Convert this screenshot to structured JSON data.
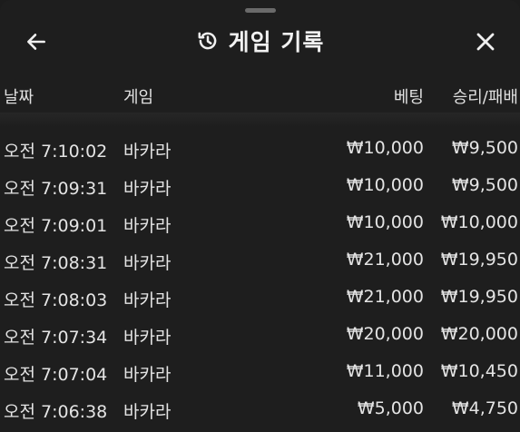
{
  "header": {
    "title": "게임 기록",
    "back_icon": "arrow-left-icon",
    "history_icon": "history-icon",
    "close_icon": "close-icon"
  },
  "columns": {
    "date": "날짜",
    "game": "게임",
    "bet": "베팅",
    "result": "승리/패배"
  },
  "rows": [
    {
      "time": "오전 7:10:02",
      "game": "바카라",
      "bet": "₩10,000",
      "result": "₩9,500"
    },
    {
      "time": "오전 7:09:31",
      "game": "바카라",
      "bet": "₩10,000",
      "result": "₩9,500"
    },
    {
      "time": "오전 7:09:01",
      "game": "바카라",
      "bet": "₩10,000",
      "result": "₩10,000"
    },
    {
      "time": "오전 7:08:31",
      "game": "바카라",
      "bet": "₩21,000",
      "result": "₩19,950"
    },
    {
      "time": "오전 7:08:03",
      "game": "바카라",
      "bet": "₩21,000",
      "result": "₩19,950"
    },
    {
      "time": "오전 7:07:34",
      "game": "바카라",
      "bet": "₩20,000",
      "result": "₩20,000"
    },
    {
      "time": "오전 7:07:04",
      "game": "바카라",
      "bet": "₩11,000",
      "result": "₩10,450"
    },
    {
      "time": "오전 7:06:38",
      "game": "바카라",
      "bet": "₩5,000",
      "result": "₩4,750"
    }
  ]
}
